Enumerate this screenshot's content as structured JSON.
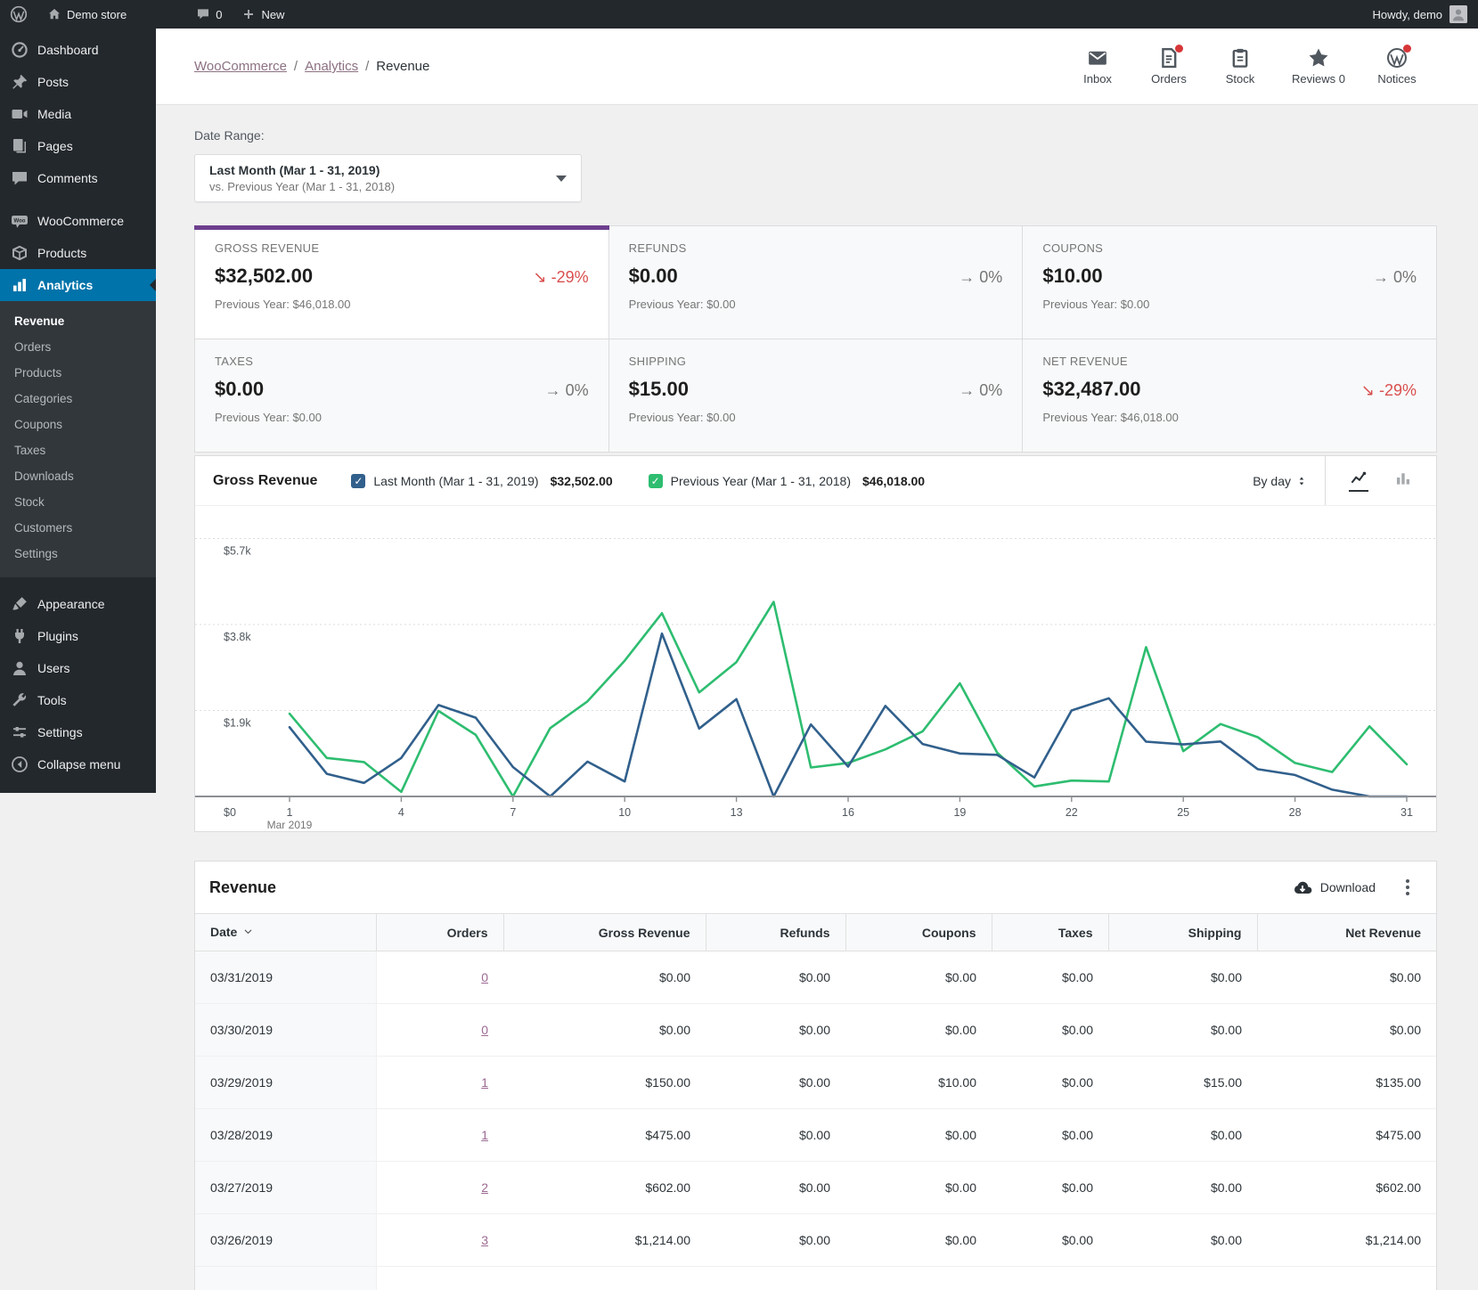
{
  "colors": {
    "accent_purple": "#6d3f8e",
    "negative_red": "#d94f4f",
    "neutral_gray": "#757575",
    "link_purple": "#9c6a93",
    "active_blue": "#0073aa",
    "badge_red": "#d63638",
    "series_blue": "#31608c",
    "series_green": "#2ebd70"
  },
  "admin_bar": {
    "site_name": "Demo store",
    "comments_count": "0",
    "new_label": "New",
    "howdy": "Howdy, demo"
  },
  "sidebar": {
    "main_items": [
      {
        "label": "Dashboard",
        "icon": "dashboard-icon"
      },
      {
        "label": "Posts",
        "icon": "pin-icon"
      },
      {
        "label": "Media",
        "icon": "media-icon"
      },
      {
        "label": "Pages",
        "icon": "pages-icon"
      },
      {
        "label": "Comments",
        "icon": "comments-icon"
      }
    ],
    "commerce_items": [
      {
        "label": "WooCommerce",
        "icon": "woocommerce-icon"
      },
      {
        "label": "Products",
        "icon": "package-icon"
      }
    ],
    "analytics_item": {
      "label": "Analytics",
      "icon": "bar-chart-icon"
    },
    "analytics_submenu": [
      {
        "label": "Revenue",
        "active": true
      },
      {
        "label": "Orders"
      },
      {
        "label": "Products"
      },
      {
        "label": "Categories"
      },
      {
        "label": "Coupons"
      },
      {
        "label": "Taxes"
      },
      {
        "label": "Downloads"
      },
      {
        "label": "Stock"
      },
      {
        "label": "Customers"
      },
      {
        "label": "Settings"
      }
    ],
    "secondary_items": [
      {
        "label": "Appearance",
        "icon": "brush-icon"
      },
      {
        "label": "Plugins",
        "icon": "plug-icon"
      },
      {
        "label": "Users",
        "icon": "user-icon"
      },
      {
        "label": "Tools",
        "icon": "wrench-icon"
      },
      {
        "label": "Settings",
        "icon": "sliders-icon"
      }
    ],
    "collapse": {
      "label": "Collapse menu",
      "icon": "collapse-icon"
    }
  },
  "header": {
    "breadcrumb": [
      {
        "label": "WooCommerce",
        "link": true
      },
      {
        "label": "Analytics",
        "link": true
      },
      {
        "label": "Revenue",
        "link": false
      }
    ],
    "separator": "/",
    "activity": [
      {
        "label": "Inbox",
        "icon": "mail-icon",
        "badge": false
      },
      {
        "label": "Orders",
        "icon": "document-icon",
        "badge": true
      },
      {
        "label": "Stock",
        "icon": "clipboard-icon",
        "badge": false
      },
      {
        "label": "Reviews 0",
        "icon": "star-icon",
        "badge": false
      },
      {
        "label": "Notices",
        "icon": "wordpress-circle-icon",
        "badge": true
      }
    ]
  },
  "date_range": {
    "label": "Date Range:",
    "primary": "Last Month (Mar 1 - 31, 2019)",
    "secondary": "vs. Previous Year (Mar 1 - 31, 2018)"
  },
  "summary_tiles": [
    {
      "label": "GROSS REVENUE",
      "value": "$32,502.00",
      "delta_arrow": "↘",
      "delta": "-29%",
      "delta_dir": "down",
      "prev": "Previous Year: $46,018.00",
      "selected": true
    },
    {
      "label": "REFUNDS",
      "value": "$0.00",
      "delta_arrow": "→",
      "delta": "0%",
      "delta_dir": "flat",
      "prev": "Previous Year: $0.00",
      "selected": false
    },
    {
      "label": "COUPONS",
      "value": "$10.00",
      "delta_arrow": "→",
      "delta": "0%",
      "delta_dir": "flat",
      "prev": "Previous Year: $0.00",
      "selected": false
    },
    {
      "label": "TAXES",
      "value": "$0.00",
      "delta_arrow": "→",
      "delta": "0%",
      "delta_dir": "flat",
      "prev": "Previous Year: $0.00",
      "selected": false
    },
    {
      "label": "SHIPPING",
      "value": "$15.00",
      "delta_arrow": "→",
      "delta": "0%",
      "delta_dir": "flat",
      "prev": "Previous Year: $0.00",
      "selected": false
    },
    {
      "label": "NET REVENUE",
      "value": "$32,487.00",
      "delta_arrow": "↘",
      "delta": "-29%",
      "delta_dir": "down",
      "prev": "Previous Year: $46,018.00",
      "selected": false
    }
  ],
  "chart_data": {
    "type": "line",
    "title": "Gross Revenue",
    "interval_label": "By day",
    "x_sub_label": "Mar 2019",
    "x_ticks": [
      1,
      4,
      7,
      10,
      13,
      16,
      19,
      22,
      25,
      28,
      31
    ],
    "y_ticks": [
      {
        "label": "$5.7k",
        "value": 5700
      },
      {
        "label": "$3.8k",
        "value": 3800
      },
      {
        "label": "$1.9k",
        "value": 1900
      },
      {
        "label": "$0",
        "value": 0
      }
    ],
    "ylim": [
      0,
      6400
    ],
    "grid": true,
    "legend_position": "top",
    "series": [
      {
        "name": "Last Month (Mar 1 - 31, 2019)",
        "total_label": "$32,502.00",
        "color": "#31608c",
        "checked": true,
        "values": [
          1530,
          500,
          300,
          850,
          2020,
          1740,
          650,
          0,
          770,
          330,
          3600,
          1500,
          2150,
          0,
          1590,
          660,
          2000,
          1160,
          950,
          920,
          420,
          1900,
          2170,
          1210,
          1150,
          1214,
          602,
          475,
          150,
          0,
          0
        ]
      },
      {
        "name": "Previous Year (Mar 1 - 31, 2018)",
        "total_label": "$46,018.00",
        "color": "#2ebd70",
        "checked": true,
        "values": [
          1830,
          850,
          760,
          100,
          1890,
          1360,
          0,
          1510,
          2100,
          3000,
          4050,
          2300,
          2970,
          4300,
          640,
          740,
          1040,
          1440,
          2500,
          970,
          220,
          350,
          330,
          3300,
          1000,
          1600,
          1310,
          740,
          540,
          1550,
          710
        ]
      }
    ]
  },
  "table": {
    "title": "Revenue",
    "download_label": "Download",
    "columns": [
      {
        "label": "Date",
        "align": "left",
        "sorted": true
      },
      {
        "label": "Orders",
        "align": "right",
        "sorted": false
      },
      {
        "label": "Gross Revenue",
        "align": "right",
        "sorted": false
      },
      {
        "label": "Refunds",
        "align": "right",
        "sorted": false
      },
      {
        "label": "Coupons",
        "align": "right",
        "sorted": false
      },
      {
        "label": "Taxes",
        "align": "right",
        "sorted": false
      },
      {
        "label": "Shipping",
        "align": "right",
        "sorted": false
      },
      {
        "label": "Net Revenue",
        "align": "right",
        "sorted": false
      }
    ],
    "rows": [
      [
        "03/31/2019",
        "0",
        "$0.00",
        "$0.00",
        "$0.00",
        "$0.00",
        "$0.00",
        "$0.00"
      ],
      [
        "03/30/2019",
        "0",
        "$0.00",
        "$0.00",
        "$0.00",
        "$0.00",
        "$0.00",
        "$0.00"
      ],
      [
        "03/29/2019",
        "1",
        "$150.00",
        "$0.00",
        "$10.00",
        "$0.00",
        "$15.00",
        "$135.00"
      ],
      [
        "03/28/2019",
        "1",
        "$475.00",
        "$0.00",
        "$0.00",
        "$0.00",
        "$0.00",
        "$475.00"
      ],
      [
        "03/27/2019",
        "2",
        "$602.00",
        "$0.00",
        "$0.00",
        "$0.00",
        "$0.00",
        "$602.00"
      ],
      [
        "03/26/2019",
        "3",
        "$1,214.00",
        "$0.00",
        "$0.00",
        "$0.00",
        "$0.00",
        "$1,214.00"
      ]
    ]
  }
}
